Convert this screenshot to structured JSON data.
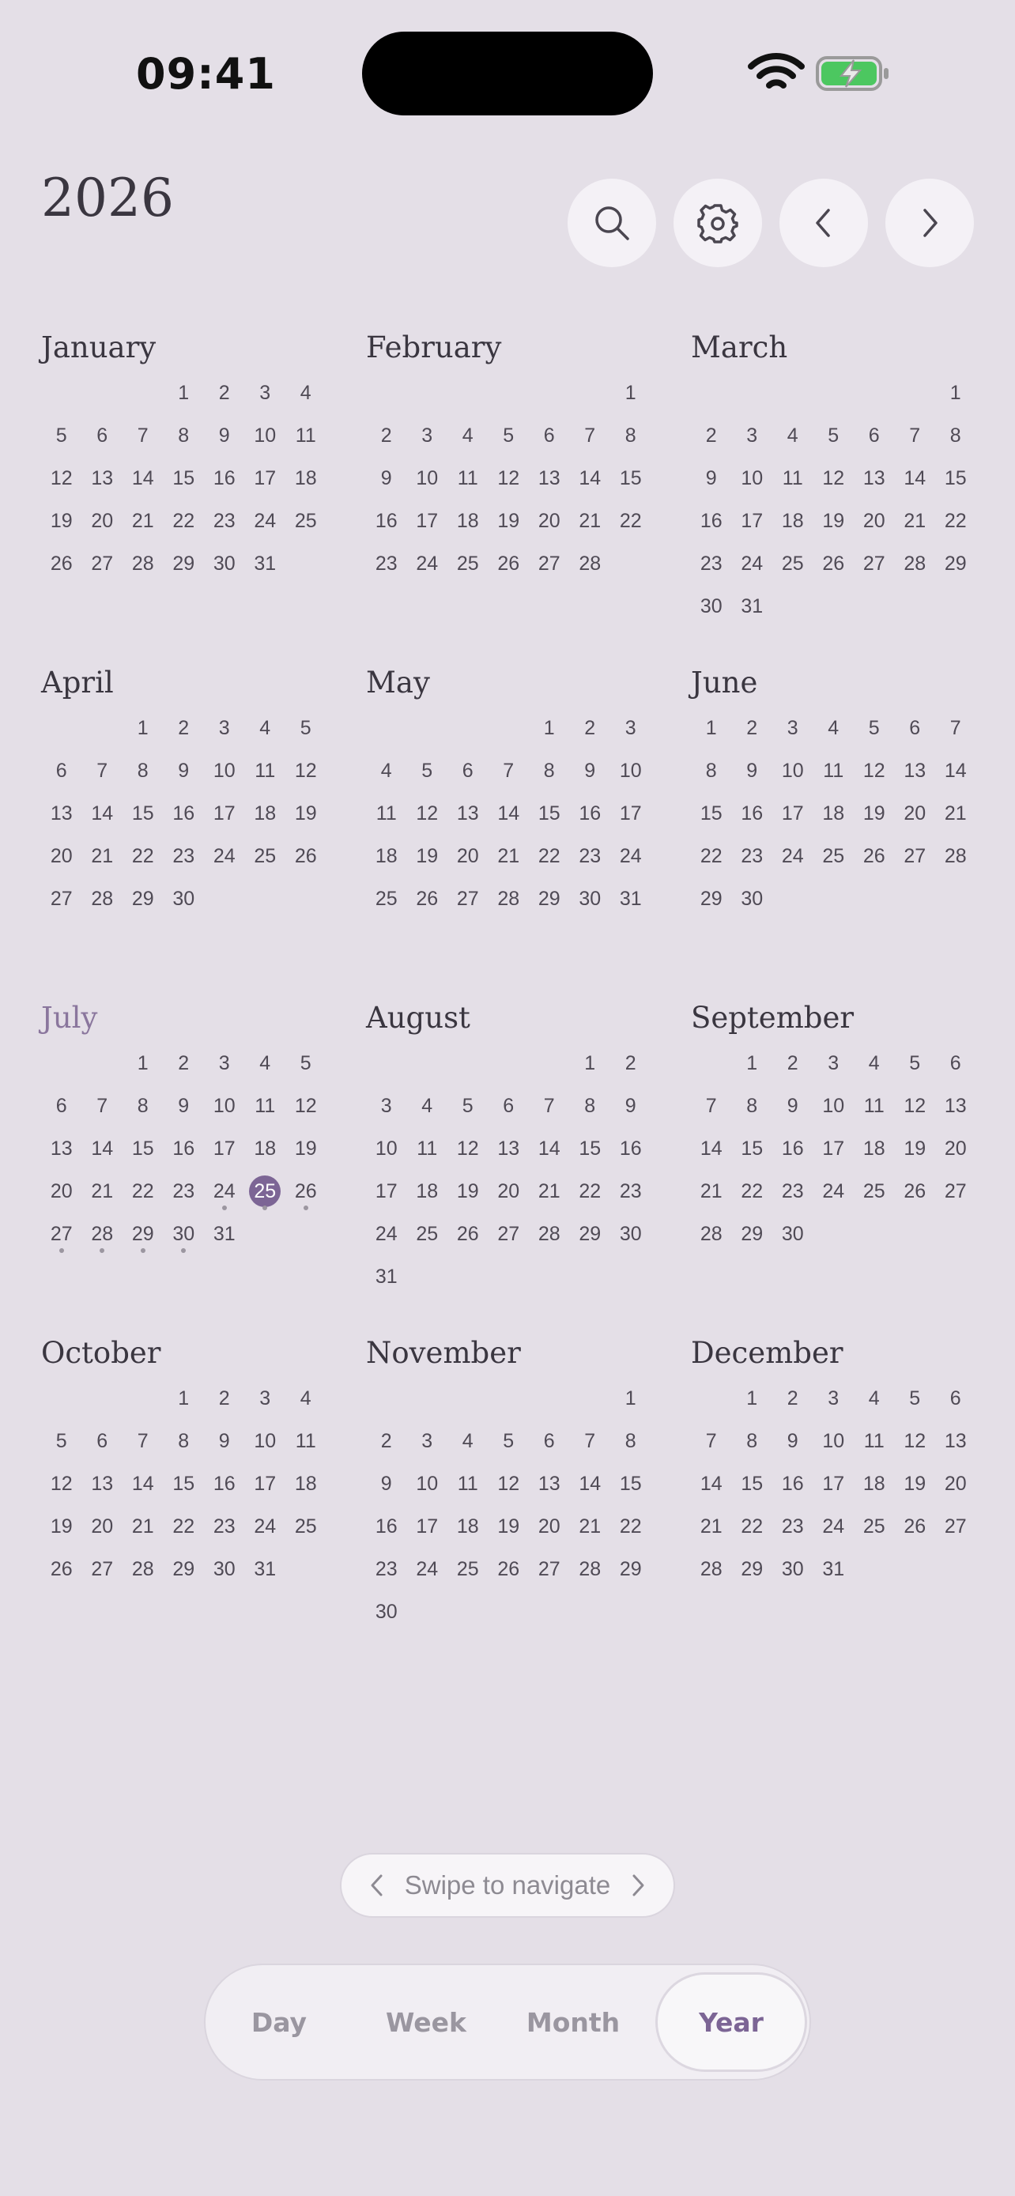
{
  "status": {
    "time": "09:41"
  },
  "header": {
    "year": "2026"
  },
  "current": {
    "month_index": 6,
    "today": 25,
    "event_days": [
      24,
      25,
      26,
      27,
      28,
      29,
      30
    ]
  },
  "months": [
    {
      "name": "January",
      "offset": 3,
      "days": 31
    },
    {
      "name": "February",
      "offset": 6,
      "days": 28
    },
    {
      "name": "March",
      "offset": 6,
      "days": 31
    },
    {
      "name": "April",
      "offset": 2,
      "days": 30
    },
    {
      "name": "May",
      "offset": 4,
      "days": 31
    },
    {
      "name": "June",
      "offset": 0,
      "days": 30
    },
    {
      "name": "July",
      "offset": 2,
      "days": 31
    },
    {
      "name": "August",
      "offset": 5,
      "days": 31
    },
    {
      "name": "September",
      "offset": 1,
      "days": 30
    },
    {
      "name": "October",
      "offset": 3,
      "days": 31
    },
    {
      "name": "November",
      "offset": 6,
      "days": 30
    },
    {
      "name": "December",
      "offset": 1,
      "days": 31
    }
  ],
  "swipe_hint": "Swipe to navigate",
  "view_tabs": [
    {
      "label": "Day"
    },
    {
      "label": "Week"
    },
    {
      "label": "Month"
    },
    {
      "label": "Year",
      "active": true
    }
  ],
  "icons": {
    "search": "search-icon",
    "settings": "gear-icon",
    "prev": "chevron-left-icon",
    "next": "chevron-right-icon"
  },
  "colors": {
    "background": "#E4DFE7",
    "accent": "#7C6595",
    "current_month": "#8A769D",
    "battery": "#4CC760"
  }
}
